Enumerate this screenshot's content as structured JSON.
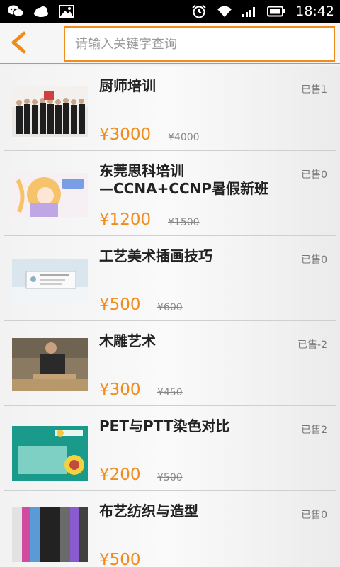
{
  "status_bar": {
    "time": "18:42",
    "left_icons": [
      "wechat-icon",
      "weather-icon",
      "gallery-icon"
    ],
    "right_icons": [
      "alarm-icon",
      "wifi-icon",
      "signal-icon",
      "battery-icon"
    ]
  },
  "header": {
    "back_icon": "chevron-left-icon",
    "search_placeholder": "请输入关键字查询",
    "accent_color": "#f08c1c"
  },
  "items": [
    {
      "title": "厨师培训",
      "sold": "已售1",
      "price": "¥3000",
      "original_price": "¥4000"
    },
    {
      "title": "东莞思科培训\n—CCNA+CCNP暑假新班",
      "sold": "已售0",
      "price": "¥1200",
      "original_price": "¥1500"
    },
    {
      "title": "工艺美术插画技巧",
      "sold": "已售0",
      "price": "¥500",
      "original_price": "¥600"
    },
    {
      "title": "木雕艺术",
      "sold": "已售-2",
      "price": "¥300",
      "original_price": "¥450"
    },
    {
      "title": "PET与PTT染色对比",
      "sold": "已售2",
      "price": "¥200",
      "original_price": "¥500"
    },
    {
      "title": "布艺纺织与造型",
      "sold": "已售0",
      "price": "¥500",
      "original_price": ""
    }
  ]
}
